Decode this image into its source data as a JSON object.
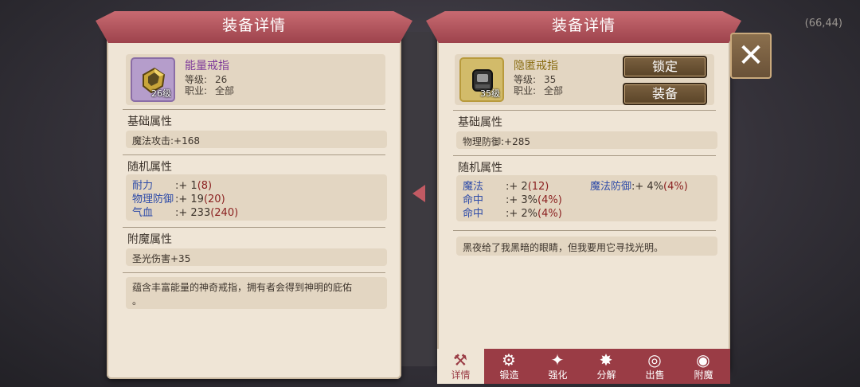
{
  "bg_coords": "(66,44)",
  "left": {
    "title": "装备详情",
    "item": {
      "name": "能量戒指",
      "level_badge": "26级",
      "level_label": "等级:",
      "level": "26",
      "job_label": "职业:",
      "job": "全部"
    },
    "base_title": "基础属性",
    "base": "魔法攻击:+168",
    "random_title": "随机属性",
    "random": [
      {
        "name": "耐力",
        "value": ":+ 1",
        "extra": "(8)"
      },
      {
        "name": "物理防御",
        "value": ":+ 19",
        "extra": "(20)"
      },
      {
        "name": "气血",
        "value": ":+ 233",
        "extra": "(240)"
      }
    ],
    "enchant_title": "附魔属性",
    "enchant": "圣光伤害+35",
    "desc": "蕴含丰富能量的神奇戒指，拥有者会得到神明的庇佑",
    "desc2": "。"
  },
  "right": {
    "title": "装备详情",
    "item": {
      "name": "隐匿戒指",
      "level_badge": "35级",
      "level_label": "等级:",
      "level": "35",
      "job_label": "职业:",
      "job": "全部"
    },
    "lock_label": "锁定",
    "equip_label": "装备",
    "base_title": "基础属性",
    "base": "物理防御:+285",
    "random_title": "随机属性",
    "random": [
      {
        "name": "魔法",
        "value": ":+ 2",
        "extra": "(12)"
      },
      {
        "name": "命中",
        "value": ":+ 3%",
        "extra": "(4%)"
      },
      {
        "name": "命中",
        "value": ":+ 2%",
        "extra": "(4%)"
      },
      {
        "name": "魔法防御",
        "value": ":+ 4%",
        "extra": "(4%)"
      }
    ],
    "desc": "黑夜给了我黑暗的眼睛，但我要用它寻找光明。"
  },
  "tabs": [
    {
      "label": "详情",
      "icon": "hammer-icon"
    },
    {
      "label": "锻造",
      "icon": "anvil-icon"
    },
    {
      "label": "强化",
      "icon": "sparkle-icon"
    },
    {
      "label": "分解",
      "icon": "burst-icon"
    },
    {
      "label": "出售",
      "icon": "coins-icon"
    },
    {
      "label": "附魔",
      "icon": "eye-icon"
    }
  ],
  "colors": {
    "ribbon": "#b05560",
    "panel": "#efe5d6",
    "attr_name": "#2c4aa8",
    "attr_extra": "#8a1f1f"
  }
}
